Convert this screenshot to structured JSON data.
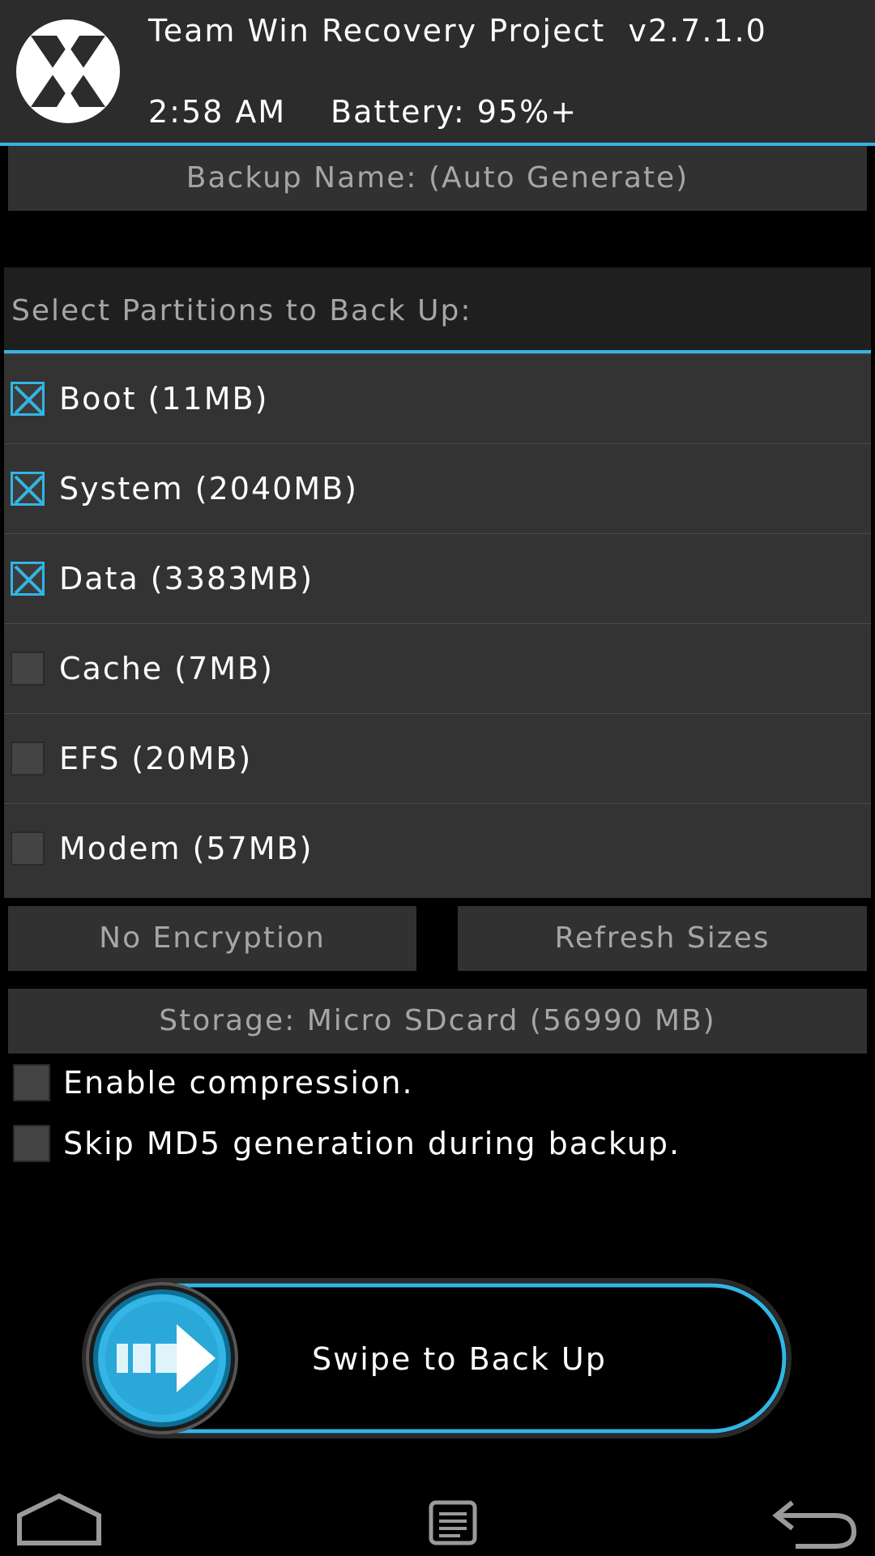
{
  "header": {
    "app_title": "Team Win Recovery Project  v2.7.1.0",
    "time": "2:58 AM",
    "battery": "Battery: 95%+"
  },
  "backup_name_button": "Backup Name: (Auto Generate)",
  "partitions": {
    "heading": "Select Partitions to Back Up:",
    "items": [
      {
        "label": "Boot (11MB)",
        "checked": true
      },
      {
        "label": "System (2040MB)",
        "checked": true
      },
      {
        "label": "Data (3383MB)",
        "checked": true
      },
      {
        "label": "Cache (7MB)",
        "checked": false
      },
      {
        "label": "EFS (20MB)",
        "checked": false
      },
      {
        "label": "Modem (57MB)",
        "checked": false
      }
    ]
  },
  "buttons": {
    "encryption": "No Encryption",
    "refresh": "Refresh Sizes",
    "storage": "Storage: Micro SDcard (56990 MB)"
  },
  "options": {
    "compression": {
      "label": "Enable compression.",
      "checked": false
    },
    "skip_md5": {
      "label": "Skip MD5 generation during backup.",
      "checked": false
    }
  },
  "swipe": {
    "label": "Swipe to Back Up"
  },
  "colors": {
    "accent": "#33b5e5",
    "header_bg": "#2c2c2c",
    "button_bg": "#313131",
    "button_text": "#a6a6a6"
  },
  "nav_icons": [
    "home-icon",
    "log-icon",
    "back-icon"
  ]
}
